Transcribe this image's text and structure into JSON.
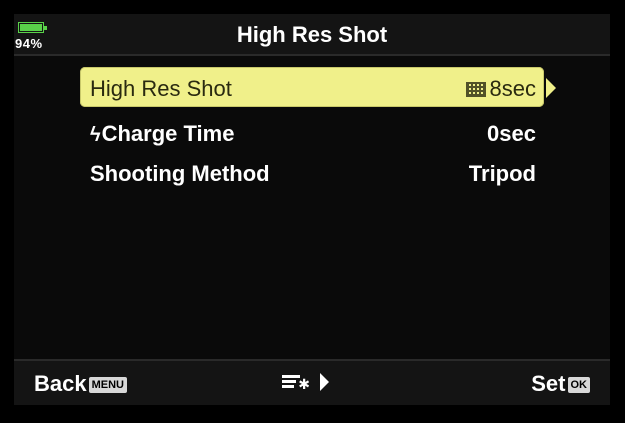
{
  "status": {
    "battery_percent": "94%"
  },
  "header": {
    "title": "High Res Shot"
  },
  "menu": {
    "items": [
      {
        "label": "High Res Shot",
        "value": "8sec",
        "icon": "grid-icon",
        "selected": true
      },
      {
        "label": "Charge Time",
        "value": "0sec",
        "icon": "flash-icon",
        "selected": false
      },
      {
        "label": "Shooting Method",
        "value": "Tripod",
        "icon": "",
        "selected": false
      }
    ]
  },
  "footer": {
    "back_label": "Back",
    "back_button": "MENU",
    "set_label": "Set",
    "set_button": "OK"
  },
  "colors": {
    "selected_bg": "#f0f08a",
    "battery": "#5ad24a"
  }
}
